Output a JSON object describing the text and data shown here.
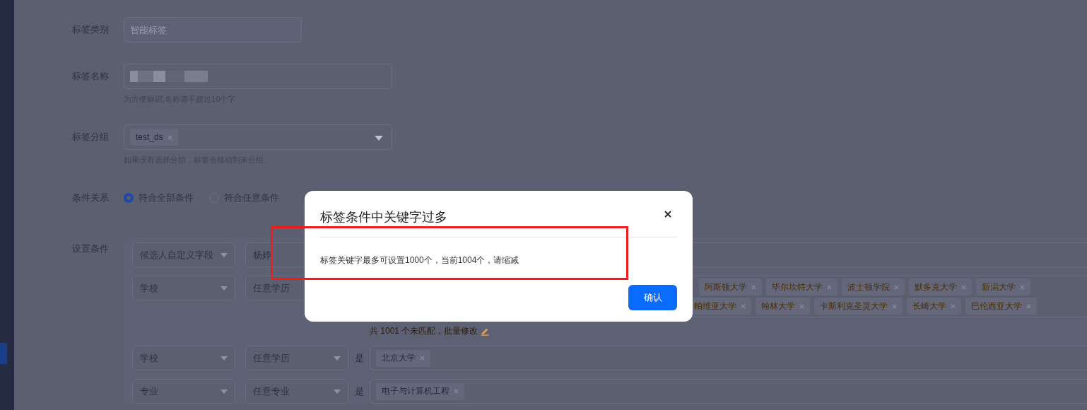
{
  "form": {
    "category": {
      "label": "标签类别",
      "placeholder": "智能标签"
    },
    "name": {
      "label": "标签名称",
      "hint": "为方便标识,名称请不超过10个字"
    },
    "group": {
      "label": "标签分组",
      "chips": [
        "test_ds"
      ],
      "hint": "如果没有选择分组，标签会移动到未分组"
    },
    "relation": {
      "label": "条件关系",
      "options": [
        {
          "label": "符合全部条件",
          "selected": true
        },
        {
          "label": "符合任意条件",
          "selected": false
        }
      ]
    },
    "conditions": {
      "label": "设置条件",
      "rows": [
        {
          "field": "候选人自定义字段",
          "scope": "杨婷"
        },
        {
          "field": "学校",
          "scope": "任意学历",
          "chip_lines": [
            [
              {
                "text": "阿斯顿大学",
                "unmatched": true
              },
              {
                "text": "毕尔坎特大学",
                "unmatched": true
              },
              {
                "text": "波士顿学院",
                "unmatched": true
              },
              {
                "text": "默多克大学",
                "unmatched": true
              },
              {
                "text": "新潟大学",
                "unmatched": true
              }
            ],
            [
              {
                "text": "帕维亚大学",
                "unmatched": true
              },
              {
                "text": "翰林大学",
                "unmatched": true
              },
              {
                "text": "卡斯利克圣灵大学",
                "unmatched": true
              },
              {
                "text": "长崎大学",
                "unmatched": true
              },
              {
                "text": "巴伦西亚大学",
                "unmatched": true
              }
            ]
          ],
          "note": "共 1001 个未匹配，批量修改"
        },
        {
          "field": "学校",
          "scope": "任意学历",
          "operator": "是",
          "chips": [
            {
              "text": "北京大学",
              "unmatched": false
            }
          ]
        },
        {
          "field": "专业",
          "scope": "任意专业",
          "operator": "是",
          "chips": [
            {
              "text": "电子与计算机工程",
              "unmatched": false
            }
          ]
        }
      ]
    }
  },
  "dialog": {
    "title": "标签条件中关键字过多",
    "message": "标签关键字最多可设置1000个，当前1004个，请缩减",
    "confirm": "确认"
  }
}
